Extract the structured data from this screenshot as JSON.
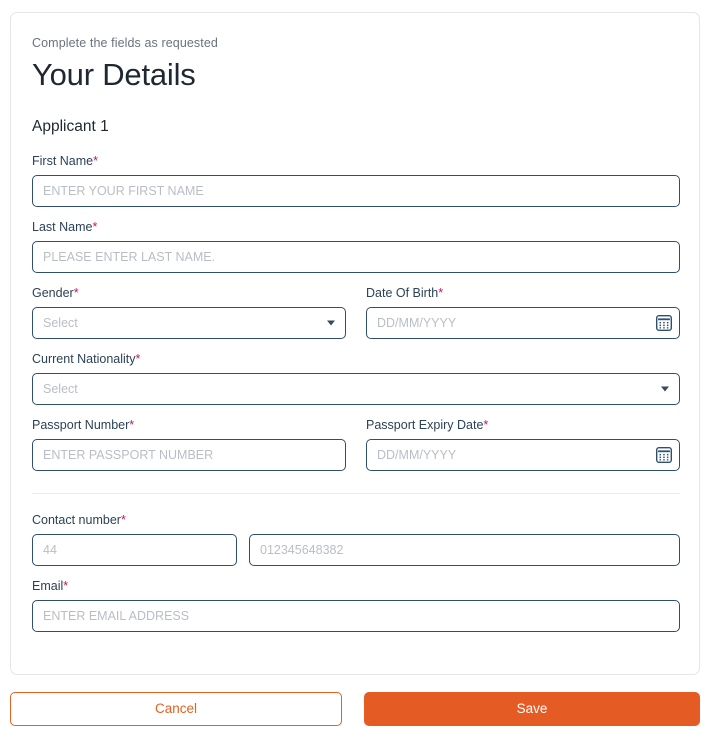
{
  "card": {
    "eyebrow": "Complete the fields as requested",
    "title": "Your Details",
    "section_heading": "Applicant 1"
  },
  "fields": {
    "first_name": {
      "label": "First Name",
      "required_mark": "*",
      "placeholder": "ENTER YOUR FIRST NAME",
      "value": ""
    },
    "last_name": {
      "label": "Last Name",
      "required_mark": "*",
      "placeholder": "PLEASE ENTER LAST NAME.",
      "value": ""
    },
    "gender": {
      "label": "Gender",
      "required_mark": "*",
      "selected": "Select",
      "icon": "chevron-down-icon"
    },
    "date_of_birth": {
      "label": "Date Of Birth",
      "required_mark": "*",
      "placeholder": "DD/MM/YYYY",
      "value": "",
      "icon": "calendar-icon"
    },
    "current_nationality": {
      "label": "Current Nationality",
      "required_mark": "*",
      "selected": "Select",
      "icon": "chevron-down-icon"
    },
    "passport_number": {
      "label": "Passport Number",
      "required_mark": "*",
      "placeholder": "ENTER PASSPORT NUMBER",
      "value": ""
    },
    "passport_expiry_date": {
      "label": "Passport Expiry Date",
      "required_mark": "*",
      "placeholder": "DD/MM/YYYY",
      "value": "",
      "icon": "calendar-icon"
    },
    "contact_number": {
      "label": "Contact number",
      "required_mark": "*",
      "country_code_placeholder": "44",
      "country_code_value": "",
      "number_placeholder": "012345648382",
      "number_value": ""
    },
    "email": {
      "label": "Email",
      "required_mark": "*",
      "placeholder": "ENTER EMAIL ADDRESS",
      "value": ""
    }
  },
  "footer": {
    "cancel_label": "Cancel",
    "save_label": "Save"
  },
  "colors": {
    "accent_orange": "#e55b24",
    "cancel_border": "#e2621f",
    "input_border": "#2f4f6f",
    "label_text": "#2c4257",
    "required_asterisk": "#c2185b",
    "placeholder": "#b9bec6",
    "card_border": "#e3e6ea",
    "title_text": "#1f2733",
    "eyebrow_text": "#6b7280"
  }
}
